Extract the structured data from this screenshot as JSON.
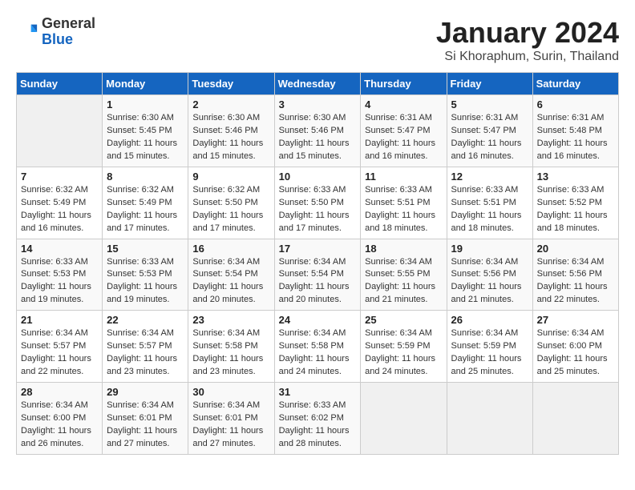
{
  "header": {
    "logo_general": "General",
    "logo_blue": "Blue",
    "title": "January 2024",
    "location": "Si Khoraphum, Surin, Thailand"
  },
  "days_of_week": [
    "Sunday",
    "Monday",
    "Tuesday",
    "Wednesday",
    "Thursday",
    "Friday",
    "Saturday"
  ],
  "weeks": [
    [
      {
        "num": "",
        "sunrise": "",
        "sunset": "",
        "daylight": ""
      },
      {
        "num": "1",
        "sunrise": "Sunrise: 6:30 AM",
        "sunset": "Sunset: 5:45 PM",
        "daylight": "Daylight: 11 hours and 15 minutes."
      },
      {
        "num": "2",
        "sunrise": "Sunrise: 6:30 AM",
        "sunset": "Sunset: 5:46 PM",
        "daylight": "Daylight: 11 hours and 15 minutes."
      },
      {
        "num": "3",
        "sunrise": "Sunrise: 6:30 AM",
        "sunset": "Sunset: 5:46 PM",
        "daylight": "Daylight: 11 hours and 15 minutes."
      },
      {
        "num": "4",
        "sunrise": "Sunrise: 6:31 AM",
        "sunset": "Sunset: 5:47 PM",
        "daylight": "Daylight: 11 hours and 16 minutes."
      },
      {
        "num": "5",
        "sunrise": "Sunrise: 6:31 AM",
        "sunset": "Sunset: 5:47 PM",
        "daylight": "Daylight: 11 hours and 16 minutes."
      },
      {
        "num": "6",
        "sunrise": "Sunrise: 6:31 AM",
        "sunset": "Sunset: 5:48 PM",
        "daylight": "Daylight: 11 hours and 16 minutes."
      }
    ],
    [
      {
        "num": "7",
        "sunrise": "Sunrise: 6:32 AM",
        "sunset": "Sunset: 5:49 PM",
        "daylight": "Daylight: 11 hours and 16 minutes."
      },
      {
        "num": "8",
        "sunrise": "Sunrise: 6:32 AM",
        "sunset": "Sunset: 5:49 PM",
        "daylight": "Daylight: 11 hours and 17 minutes."
      },
      {
        "num": "9",
        "sunrise": "Sunrise: 6:32 AM",
        "sunset": "Sunset: 5:50 PM",
        "daylight": "Daylight: 11 hours and 17 minutes."
      },
      {
        "num": "10",
        "sunrise": "Sunrise: 6:33 AM",
        "sunset": "Sunset: 5:50 PM",
        "daylight": "Daylight: 11 hours and 17 minutes."
      },
      {
        "num": "11",
        "sunrise": "Sunrise: 6:33 AM",
        "sunset": "Sunset: 5:51 PM",
        "daylight": "Daylight: 11 hours and 18 minutes."
      },
      {
        "num": "12",
        "sunrise": "Sunrise: 6:33 AM",
        "sunset": "Sunset: 5:51 PM",
        "daylight": "Daylight: 11 hours and 18 minutes."
      },
      {
        "num": "13",
        "sunrise": "Sunrise: 6:33 AM",
        "sunset": "Sunset: 5:52 PM",
        "daylight": "Daylight: 11 hours and 18 minutes."
      }
    ],
    [
      {
        "num": "14",
        "sunrise": "Sunrise: 6:33 AM",
        "sunset": "Sunset: 5:53 PM",
        "daylight": "Daylight: 11 hours and 19 minutes."
      },
      {
        "num": "15",
        "sunrise": "Sunrise: 6:33 AM",
        "sunset": "Sunset: 5:53 PM",
        "daylight": "Daylight: 11 hours and 19 minutes."
      },
      {
        "num": "16",
        "sunrise": "Sunrise: 6:34 AM",
        "sunset": "Sunset: 5:54 PM",
        "daylight": "Daylight: 11 hours and 20 minutes."
      },
      {
        "num": "17",
        "sunrise": "Sunrise: 6:34 AM",
        "sunset": "Sunset: 5:54 PM",
        "daylight": "Daylight: 11 hours and 20 minutes."
      },
      {
        "num": "18",
        "sunrise": "Sunrise: 6:34 AM",
        "sunset": "Sunset: 5:55 PM",
        "daylight": "Daylight: 11 hours and 21 minutes."
      },
      {
        "num": "19",
        "sunrise": "Sunrise: 6:34 AM",
        "sunset": "Sunset: 5:56 PM",
        "daylight": "Daylight: 11 hours and 21 minutes."
      },
      {
        "num": "20",
        "sunrise": "Sunrise: 6:34 AM",
        "sunset": "Sunset: 5:56 PM",
        "daylight": "Daylight: 11 hours and 22 minutes."
      }
    ],
    [
      {
        "num": "21",
        "sunrise": "Sunrise: 6:34 AM",
        "sunset": "Sunset: 5:57 PM",
        "daylight": "Daylight: 11 hours and 22 minutes."
      },
      {
        "num": "22",
        "sunrise": "Sunrise: 6:34 AM",
        "sunset": "Sunset: 5:57 PM",
        "daylight": "Daylight: 11 hours and 23 minutes."
      },
      {
        "num": "23",
        "sunrise": "Sunrise: 6:34 AM",
        "sunset": "Sunset: 5:58 PM",
        "daylight": "Daylight: 11 hours and 23 minutes."
      },
      {
        "num": "24",
        "sunrise": "Sunrise: 6:34 AM",
        "sunset": "Sunset: 5:58 PM",
        "daylight": "Daylight: 11 hours and 24 minutes."
      },
      {
        "num": "25",
        "sunrise": "Sunrise: 6:34 AM",
        "sunset": "Sunset: 5:59 PM",
        "daylight": "Daylight: 11 hours and 24 minutes."
      },
      {
        "num": "26",
        "sunrise": "Sunrise: 6:34 AM",
        "sunset": "Sunset: 5:59 PM",
        "daylight": "Daylight: 11 hours and 25 minutes."
      },
      {
        "num": "27",
        "sunrise": "Sunrise: 6:34 AM",
        "sunset": "Sunset: 6:00 PM",
        "daylight": "Daylight: 11 hours and 25 minutes."
      }
    ],
    [
      {
        "num": "28",
        "sunrise": "Sunrise: 6:34 AM",
        "sunset": "Sunset: 6:00 PM",
        "daylight": "Daylight: 11 hours and 26 minutes."
      },
      {
        "num": "29",
        "sunrise": "Sunrise: 6:34 AM",
        "sunset": "Sunset: 6:01 PM",
        "daylight": "Daylight: 11 hours and 27 minutes."
      },
      {
        "num": "30",
        "sunrise": "Sunrise: 6:34 AM",
        "sunset": "Sunset: 6:01 PM",
        "daylight": "Daylight: 11 hours and 27 minutes."
      },
      {
        "num": "31",
        "sunrise": "Sunrise: 6:33 AM",
        "sunset": "Sunset: 6:02 PM",
        "daylight": "Daylight: 11 hours and 28 minutes."
      },
      {
        "num": "",
        "sunrise": "",
        "sunset": "",
        "daylight": ""
      },
      {
        "num": "",
        "sunrise": "",
        "sunset": "",
        "daylight": ""
      },
      {
        "num": "",
        "sunrise": "",
        "sunset": "",
        "daylight": ""
      }
    ]
  ]
}
